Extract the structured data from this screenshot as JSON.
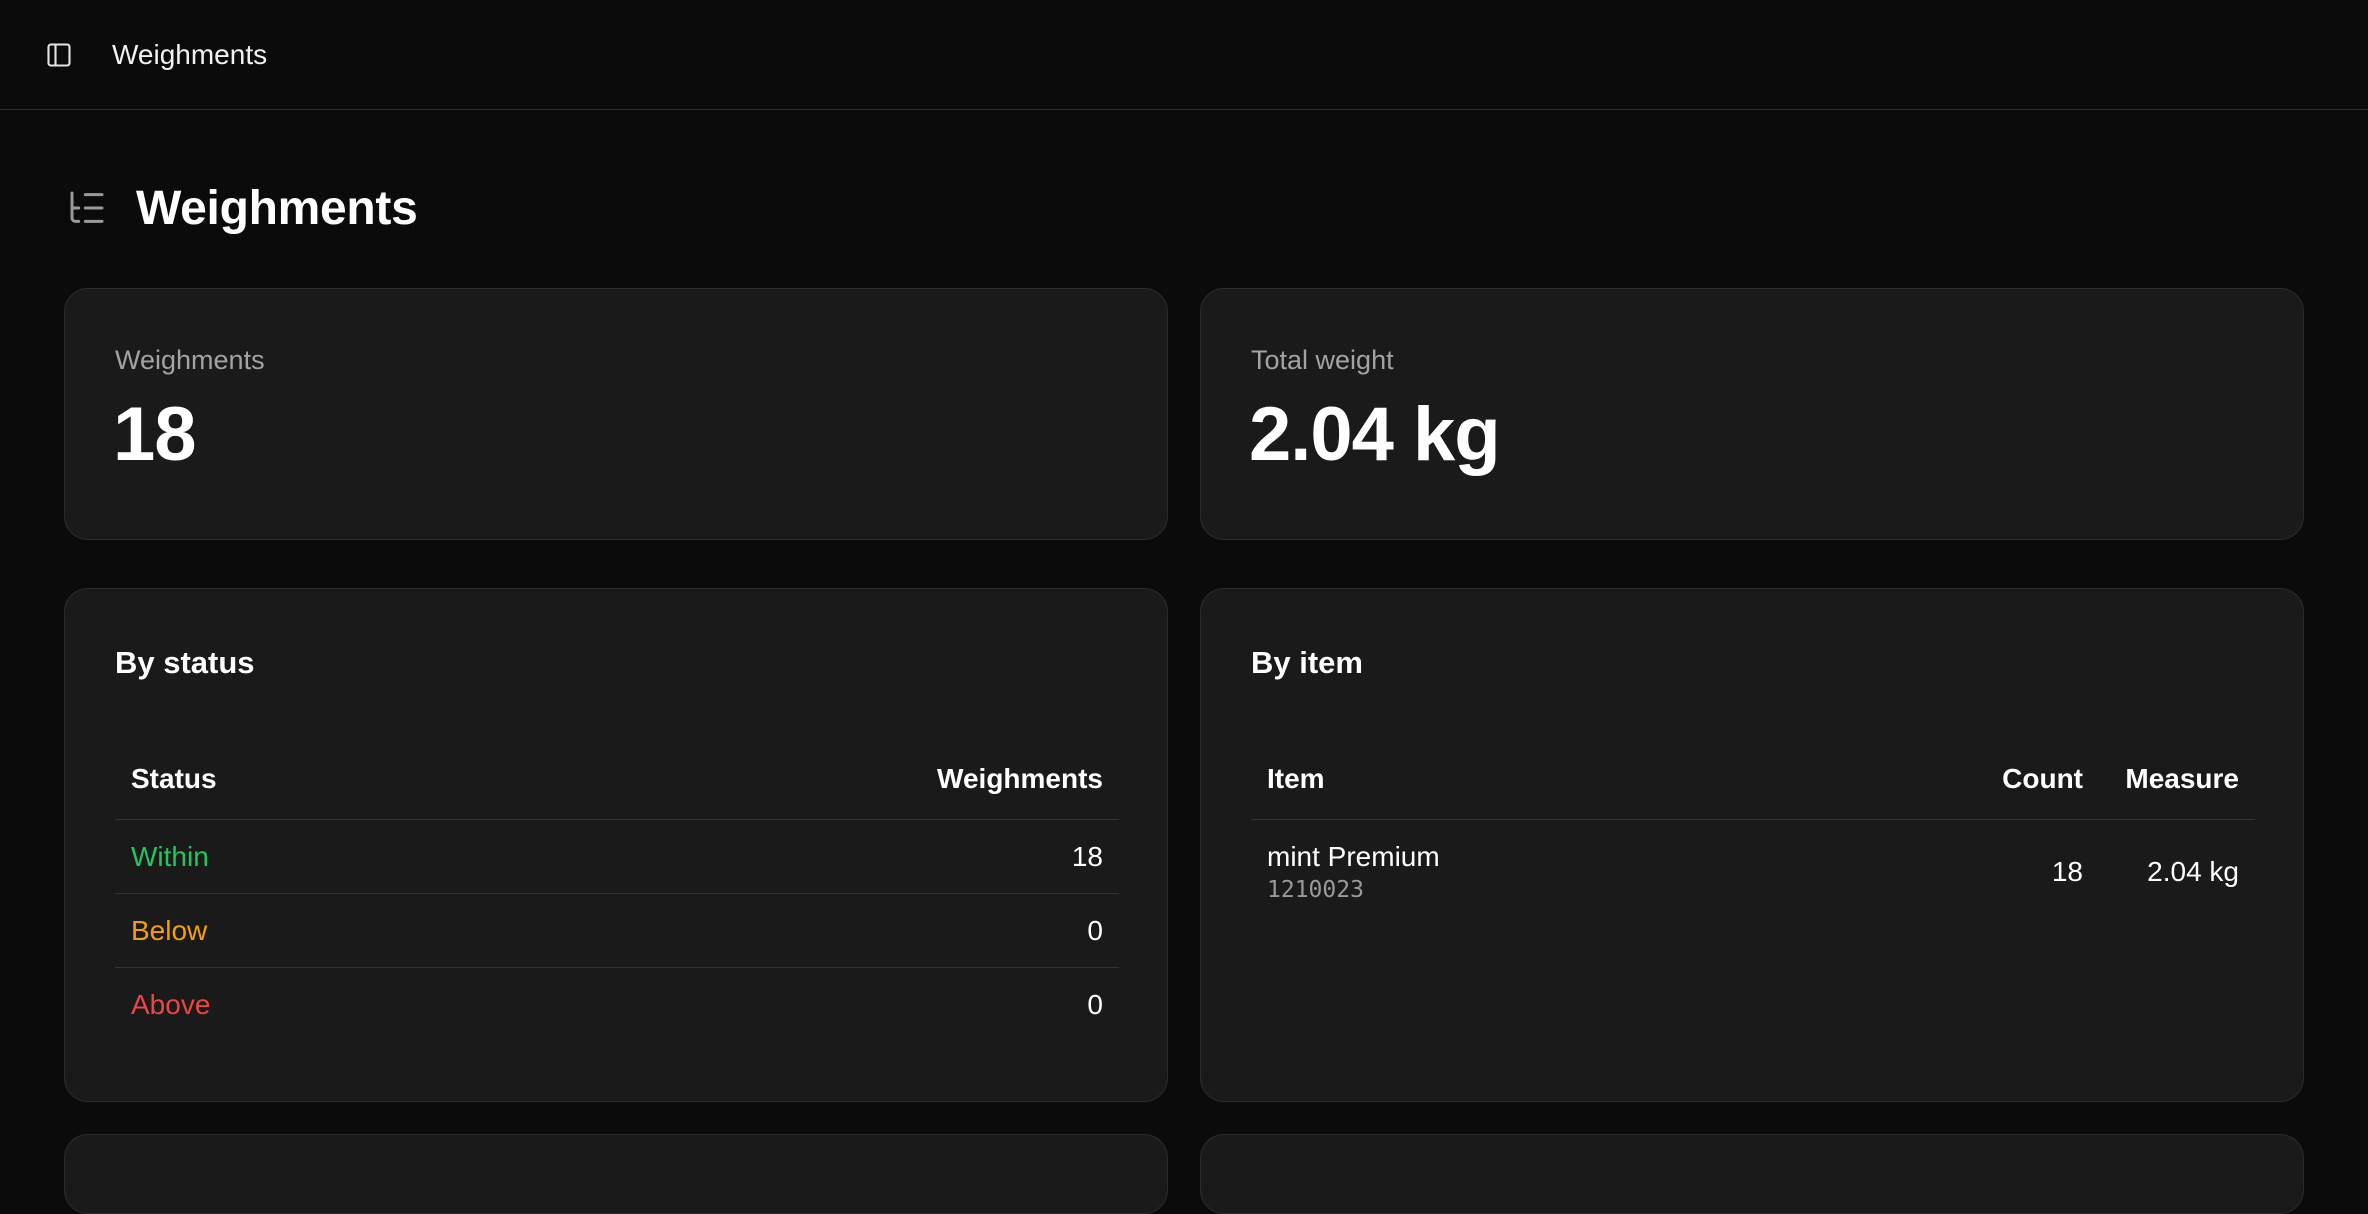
{
  "topbar": {
    "title": "Weighments",
    "toggle_icon": "sidebar-toggle-icon"
  },
  "page": {
    "title": "Weighments",
    "icon": "list-tree-icon"
  },
  "stats": {
    "weighments": {
      "label": "Weighments",
      "value": "18"
    },
    "total_weight": {
      "label": "Total weight",
      "value": "2.04 kg"
    }
  },
  "by_status": {
    "title": "By status",
    "columns": {
      "status": "Status",
      "weighments": "Weighments"
    },
    "rows": [
      {
        "status": "Within",
        "count": "18",
        "color": "#22c55e"
      },
      {
        "status": "Below",
        "count": "0",
        "color": "#f59e0b"
      },
      {
        "status": "Above",
        "count": "0",
        "color": "#ef4444"
      }
    ]
  },
  "by_item": {
    "title": "By item",
    "columns": {
      "item": "Item",
      "count": "Count",
      "measure": "Measure"
    },
    "rows": [
      {
        "name": "mint Premium",
        "code": "1210023",
        "count": "18",
        "measure": "2.04 kg"
      }
    ]
  }
}
